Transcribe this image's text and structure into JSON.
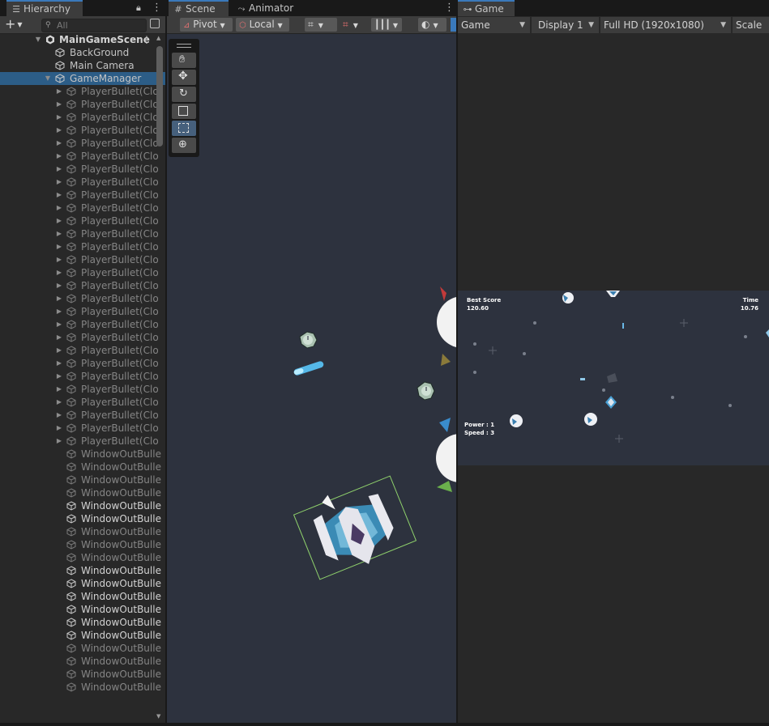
{
  "hierarchy": {
    "tab_label": "Hierarchy",
    "search_placeholder": "All",
    "add_label": "+",
    "scene_name": "MainGameScene",
    "rows": [
      {
        "label": "BackGround",
        "depth": 1,
        "state": "normal",
        "expand": ""
      },
      {
        "label": "Main Camera",
        "depth": 1,
        "state": "normal",
        "expand": ""
      },
      {
        "label": "GameManager",
        "depth": 1,
        "state": "selected",
        "expand": "open"
      },
      {
        "label": "PlayerBullet(Clo",
        "depth": 2,
        "state": "dim",
        "expand": "closed"
      },
      {
        "label": "PlayerBullet(Clo",
        "depth": 2,
        "state": "dim",
        "expand": "closed"
      },
      {
        "label": "PlayerBullet(Clo",
        "depth": 2,
        "state": "dim",
        "expand": "closed"
      },
      {
        "label": "PlayerBullet(Clo",
        "depth": 2,
        "state": "dim",
        "expand": "closed"
      },
      {
        "label": "PlayerBullet(Clo",
        "depth": 2,
        "state": "dim",
        "expand": "closed"
      },
      {
        "label": "PlayerBullet(Clo",
        "depth": 2,
        "state": "dim",
        "expand": "closed"
      },
      {
        "label": "PlayerBullet(Clo",
        "depth": 2,
        "state": "dim",
        "expand": "closed"
      },
      {
        "label": "PlayerBullet(Clo",
        "depth": 2,
        "state": "dim",
        "expand": "closed"
      },
      {
        "label": "PlayerBullet(Clo",
        "depth": 2,
        "state": "dim",
        "expand": "closed"
      },
      {
        "label": "PlayerBullet(Clo",
        "depth": 2,
        "state": "dim",
        "expand": "closed"
      },
      {
        "label": "PlayerBullet(Clo",
        "depth": 2,
        "state": "dim",
        "expand": "closed"
      },
      {
        "label": "PlayerBullet(Clo",
        "depth": 2,
        "state": "dim",
        "expand": "closed"
      },
      {
        "label": "PlayerBullet(Clo",
        "depth": 2,
        "state": "dim",
        "expand": "closed"
      },
      {
        "label": "PlayerBullet(Clo",
        "depth": 2,
        "state": "dim",
        "expand": "closed"
      },
      {
        "label": "PlayerBullet(Clo",
        "depth": 2,
        "state": "dim",
        "expand": "closed"
      },
      {
        "label": "PlayerBullet(Clo",
        "depth": 2,
        "state": "dim",
        "expand": "closed"
      },
      {
        "label": "PlayerBullet(Clo",
        "depth": 2,
        "state": "dim",
        "expand": "closed"
      },
      {
        "label": "PlayerBullet(Clo",
        "depth": 2,
        "state": "dim",
        "expand": "closed"
      },
      {
        "label": "PlayerBullet(Clo",
        "depth": 2,
        "state": "dim",
        "expand": "closed"
      },
      {
        "label": "PlayerBullet(Clo",
        "depth": 2,
        "state": "dim",
        "expand": "closed"
      },
      {
        "label": "PlayerBullet(Clo",
        "depth": 2,
        "state": "dim",
        "expand": "closed"
      },
      {
        "label": "PlayerBullet(Clo",
        "depth": 2,
        "state": "dim",
        "expand": "closed"
      },
      {
        "label": "PlayerBullet(Clo",
        "depth": 2,
        "state": "dim",
        "expand": "closed"
      },
      {
        "label": "PlayerBullet(Clo",
        "depth": 2,
        "state": "dim",
        "expand": "closed"
      },
      {
        "label": "PlayerBullet(Clo",
        "depth": 2,
        "state": "dim",
        "expand": "closed"
      },
      {
        "label": "PlayerBullet(Clo",
        "depth": 2,
        "state": "dim",
        "expand": "closed"
      },
      {
        "label": "PlayerBullet(Clo",
        "depth": 2,
        "state": "dim",
        "expand": "closed"
      },
      {
        "label": "PlayerBullet(Clo",
        "depth": 2,
        "state": "dim",
        "expand": "closed"
      },
      {
        "label": "WindowOutBulle",
        "depth": 2,
        "state": "dim",
        "expand": ""
      },
      {
        "label": "WindowOutBulle",
        "depth": 2,
        "state": "dim",
        "expand": ""
      },
      {
        "label": "WindowOutBulle",
        "depth": 2,
        "state": "dim",
        "expand": ""
      },
      {
        "label": "WindowOutBulle",
        "depth": 2,
        "state": "dim",
        "expand": ""
      },
      {
        "label": "WindowOutBulle",
        "depth": 2,
        "state": "bright",
        "expand": ""
      },
      {
        "label": "WindowOutBulle",
        "depth": 2,
        "state": "bright",
        "expand": ""
      },
      {
        "label": "WindowOutBulle",
        "depth": 2,
        "state": "dim",
        "expand": ""
      },
      {
        "label": "WindowOutBulle",
        "depth": 2,
        "state": "dim",
        "expand": ""
      },
      {
        "label": "WindowOutBulle",
        "depth": 2,
        "state": "dim",
        "expand": ""
      },
      {
        "label": "WindowOutBulle",
        "depth": 2,
        "state": "bright",
        "expand": ""
      },
      {
        "label": "WindowOutBulle",
        "depth": 2,
        "state": "bright",
        "expand": ""
      },
      {
        "label": "WindowOutBulle",
        "depth": 2,
        "state": "bright",
        "expand": ""
      },
      {
        "label": "WindowOutBulle",
        "depth": 2,
        "state": "bright",
        "expand": ""
      },
      {
        "label": "WindowOutBulle",
        "depth": 2,
        "state": "bright",
        "expand": ""
      },
      {
        "label": "WindowOutBulle",
        "depth": 2,
        "state": "bright",
        "expand": ""
      },
      {
        "label": "WindowOutBulle",
        "depth": 2,
        "state": "dim",
        "expand": ""
      },
      {
        "label": "WindowOutBulle",
        "depth": 2,
        "state": "dim",
        "expand": ""
      },
      {
        "label": "WindowOutBulle",
        "depth": 2,
        "state": "dim",
        "expand": ""
      },
      {
        "label": "WindowOutBulle",
        "depth": 2,
        "state": "dim",
        "expand": ""
      }
    ]
  },
  "scene": {
    "tab_label": "Scene",
    "animator_tab_label": "Animator",
    "pivot_label": "Pivot",
    "local_label": "Local"
  },
  "game": {
    "tab_label": "Game",
    "view_select": "Game",
    "display_select": "Display 1",
    "resolution_select": "Full HD (1920x1080)",
    "scale_label": "Scale",
    "hud": {
      "best_score_label": "Best Score",
      "best_score_value": "120.60",
      "time_label": "Time",
      "time_value": "10.76",
      "power_text": "Power : 1",
      "speed_text": "Speed : 3"
    }
  },
  "colors": {
    "selection": "#2c5d87",
    "accent": "#3a79bb",
    "scene_bg": "#2d323e",
    "panel_bg": "#282828"
  }
}
